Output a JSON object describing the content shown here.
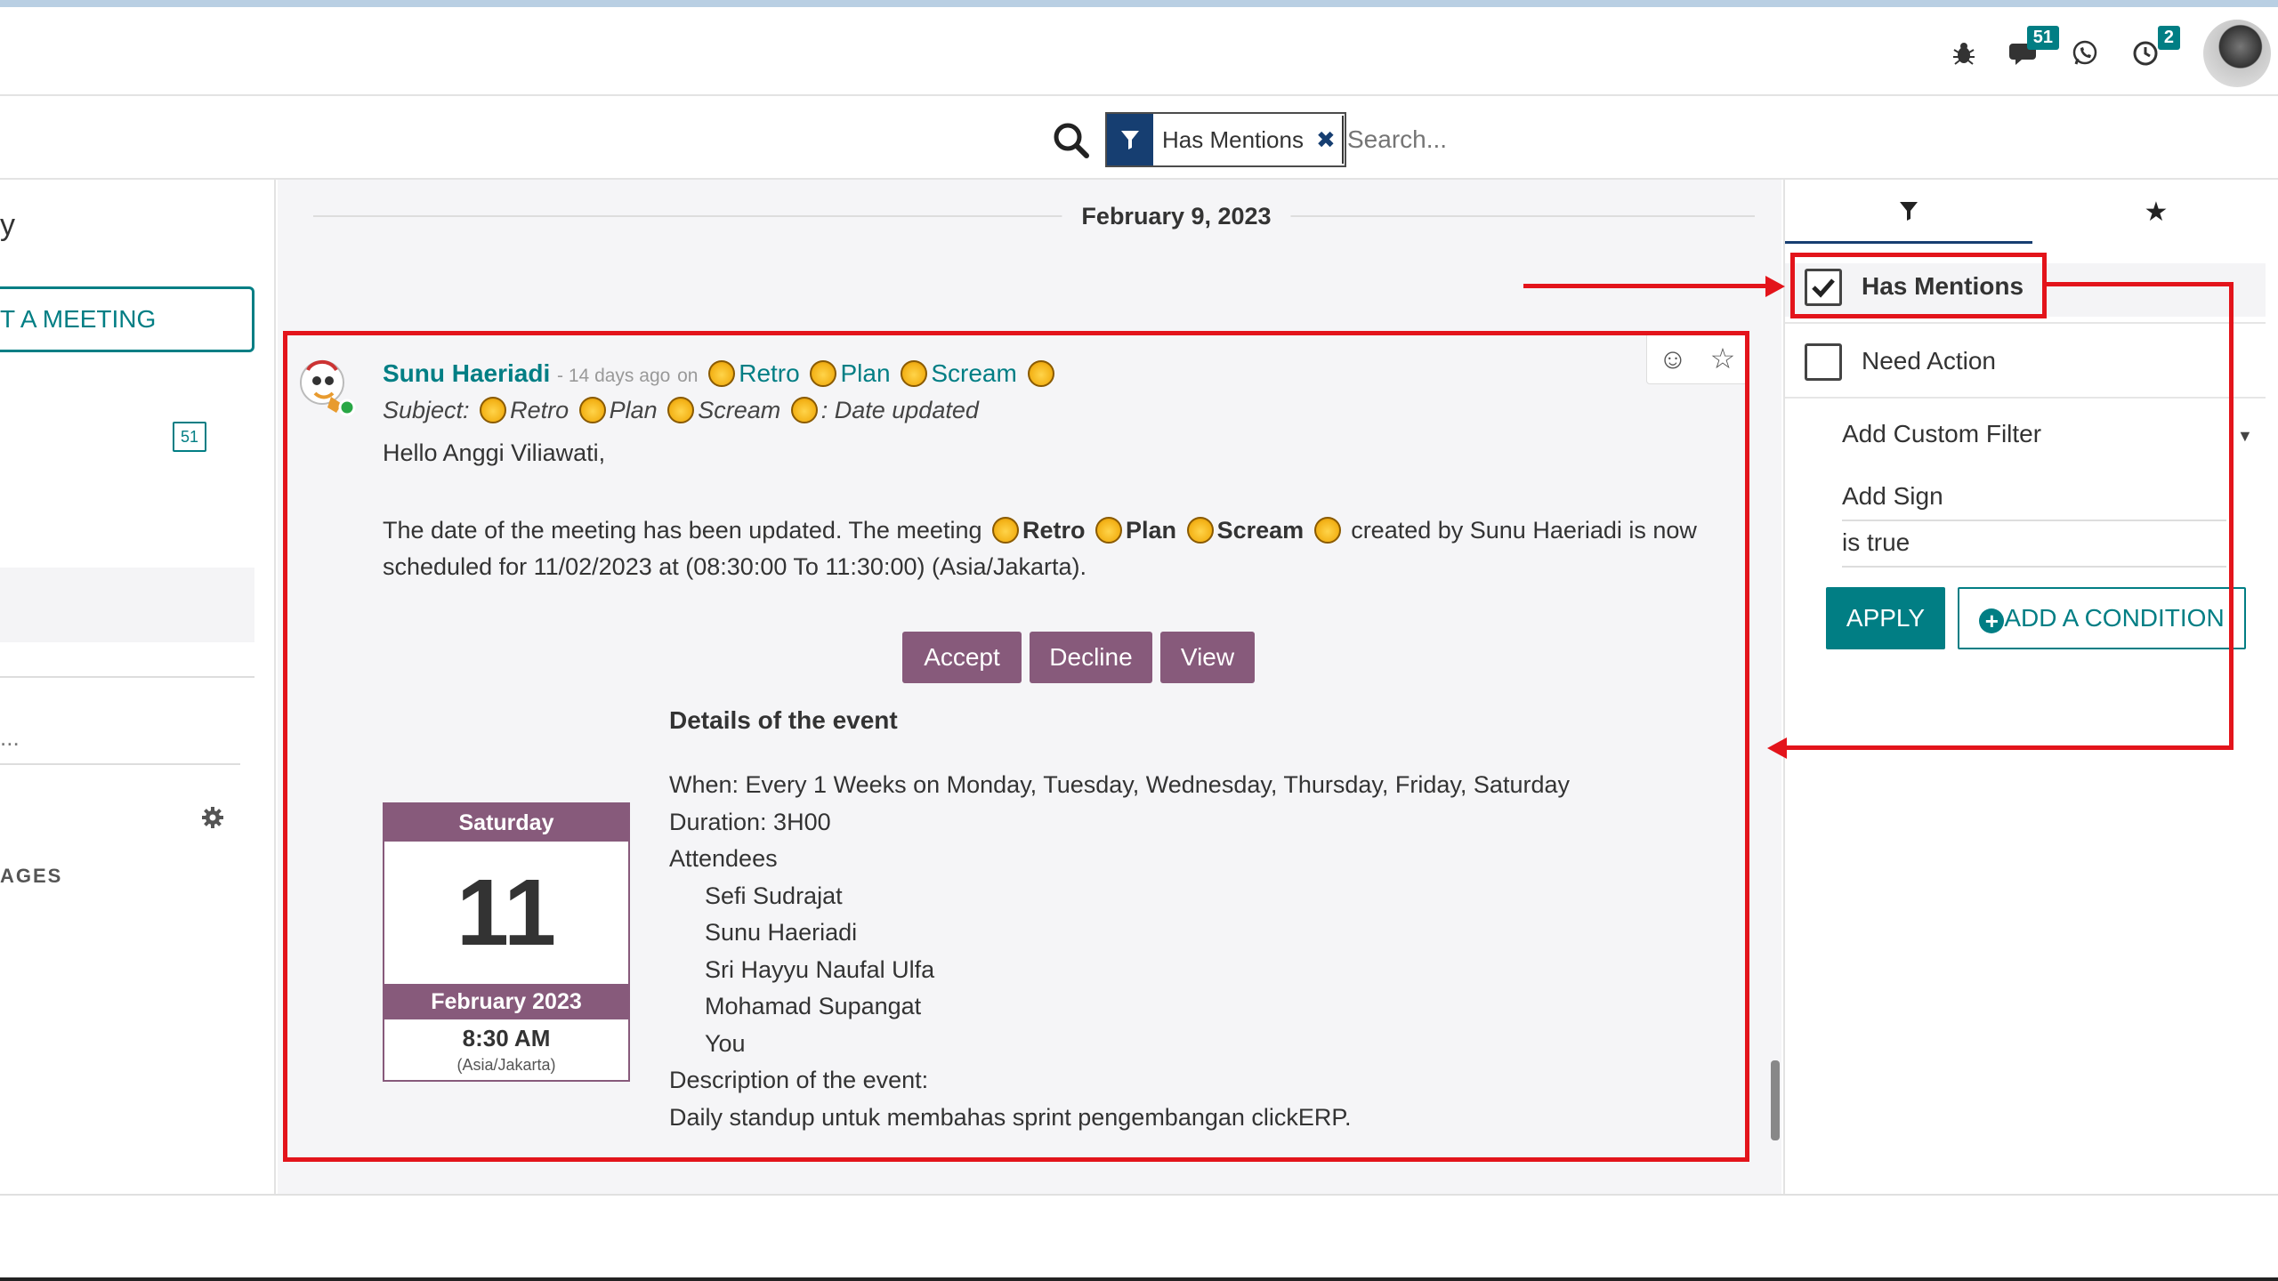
{
  "colors": {
    "accent": "#017e84",
    "event_purple": "#875a7b",
    "facet_navy": "#163e71",
    "annotation_red": "#e3141b"
  },
  "systray": {
    "icons": [
      "bug-icon",
      "chat-icon",
      "whatsapp-icon",
      "activity-clock-icon"
    ],
    "messages_badge": "51",
    "activities_badge": "2"
  },
  "search": {
    "facet_label": "Has Mentions",
    "placeholder": "Search..."
  },
  "sidebar": {
    "meeting_button": "T A MEETING",
    "inbox_badge": "51",
    "truncated_item": "...",
    "section_label": "AGES",
    "partial_heading": "y"
  },
  "thread": {
    "date": "February 9, 2023",
    "message": {
      "author": "Sunu Haeriadi",
      "time_ago": "- 14 days ago",
      "on_word": "on",
      "record": [
        "Retro",
        "Plan",
        "Scream"
      ],
      "subject_prefix": "Subject:",
      "subject_suffix": ": Date updated",
      "greeting": "Hello Anggi Viliawati,",
      "body_start": "The date of the meeting has been updated. The meeting",
      "body_end": "created by Sunu Haeriadi is now scheduled for 11/02/2023 at (08:30:00 To 11:30:00) (Asia/Jakarta).",
      "buttons": {
        "accept": "Accept",
        "decline": "Decline",
        "view": "View"
      },
      "details_title": "Details of the event",
      "when": "When: Every 1 Weeks on Monday, Tuesday, Wednesday, Thursday, Friday, Saturday",
      "duration": "Duration: 3H00",
      "attendees_label": "Attendees",
      "attendees": [
        "Sefi Sudrajat",
        "Sunu Haeriadi",
        "Sri Hayyu Naufal Ulfa",
        "Mohamad Supangat",
        "You"
      ],
      "description_label": "Description of the event:",
      "description": "Daily standup untuk membahas sprint pengembangan clickERP.",
      "calendar": {
        "weekday": "Saturday",
        "day": "11",
        "month": "February 2023",
        "time": "8:30 AM",
        "tz": "(Asia/Jakarta)"
      }
    }
  },
  "filters": {
    "has_mentions": "Has Mentions",
    "has_mentions_checked": true,
    "need_action": "Need Action",
    "need_action_checked": false,
    "add_custom_filter": "Add Custom Filter",
    "condition_field": "Add Sign",
    "condition_value": "is true",
    "apply": "APPLY",
    "add_condition": "ADD A CONDITION"
  }
}
